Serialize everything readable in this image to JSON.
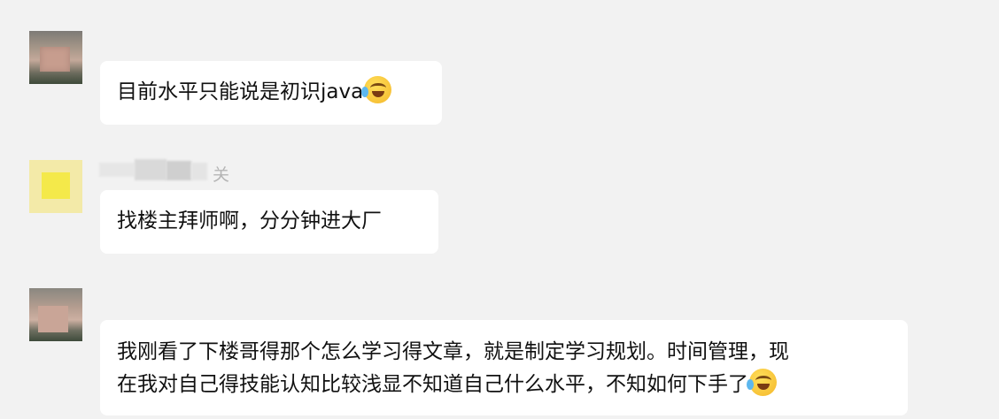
{
  "messages": [
    {
      "text": "目前水平只能说是初识java",
      "emoji": "face-with-tears-of-joy"
    },
    {
      "sender_suffix": "关",
      "text": "找楼主拜师啊，分分钟进大厂"
    },
    {
      "line1": "我刚看了下楼哥得那个怎么学习得文章，就是制定学习规划。时间管理，现",
      "line2": "在我对自己得技能认知比较浅显不知道自己什么水平，不知如何下手了",
      "emoji": "face-with-tears-of-joy"
    }
  ]
}
